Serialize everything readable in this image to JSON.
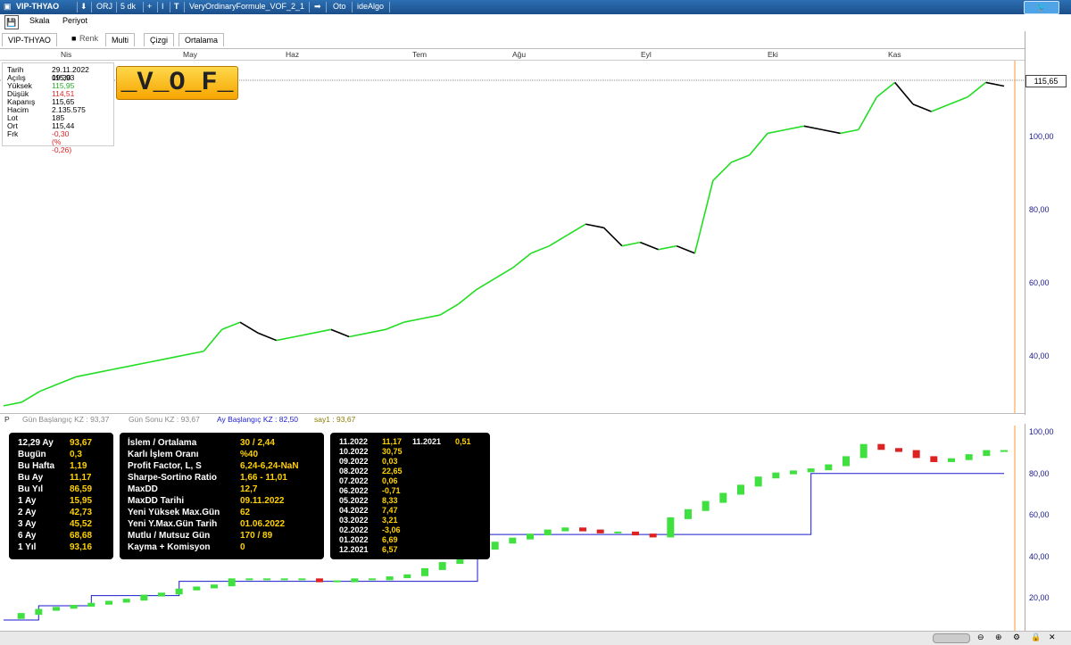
{
  "titlebar": {
    "symbol": "VIP-THYAO",
    "type": "ORJ",
    "period": "5 dk",
    "formula": "VeryOrdinaryFormule_VOF_2_1",
    "mode": "Oto",
    "app": "ideAlgo"
  },
  "menu": {
    "scale": "Skala",
    "period": "Periyot"
  },
  "tabs": {
    "symbol": "VIP-THYAO",
    "color": "Renk",
    "multi": "Multi",
    "line": "Çizgi",
    "average": "Ortalama"
  },
  "months": [
    "Nis",
    "May",
    "Haz",
    "Tem",
    "Ağu",
    "Eyl",
    "Eki",
    "Kas"
  ],
  "y_axis_top": [
    "100,00",
    "80,00",
    "60,00",
    "40,00"
  ],
  "y_axis_bottom": [
    "100,00",
    "80,00",
    "60,00",
    "40,00",
    "20,00"
  ],
  "current_price": "115,65",
  "logo_text": "_V_O_F_",
  "info": [
    {
      "label": "Tarih",
      "value": "29.11.2022 09:30"
    },
    {
      "label": "Açılış",
      "value": "115,93"
    },
    {
      "label": "Yüksek",
      "value": "115,95"
    },
    {
      "label": "Düşük",
      "value": "114,51"
    },
    {
      "label": "Kapanış",
      "value": "115,65"
    },
    {
      "label": "Hacim",
      "value": "2.135.575"
    },
    {
      "label": "Lot",
      "value": "185"
    },
    {
      "label": "Ort",
      "value": "115,44"
    },
    {
      "label": "Frk",
      "value": "-0,30 (% -0,26)"
    }
  ],
  "status": {
    "p": "P",
    "day_start": "Gün Başlangıç KZ : 93,37",
    "day_end": "Gün Sonu KZ : 93,67",
    "month_start": "Ay Başlangıç KZ : 82,50",
    "say1": "say1 : 93,67"
  },
  "perf": [
    {
      "label": "12,29 Ay",
      "value": "93,67"
    },
    {
      "label": "Bugün",
      "value": "0,3"
    },
    {
      "label": "Bu Hafta",
      "value": "1,19"
    },
    {
      "label": "Bu Ay",
      "value": "11,17"
    },
    {
      "label": "Bu Yıl",
      "value": "86,59"
    },
    {
      "label": "1 Ay",
      "value": "15,95"
    },
    {
      "label": "2 Ay",
      "value": "42,73"
    },
    {
      "label": "3 Ay",
      "value": "45,52"
    },
    {
      "label": "6 Ay",
      "value": "68,68"
    },
    {
      "label": "1 Yıl",
      "value": "93,16"
    }
  ],
  "stats": [
    {
      "label": "İslem / Ortalama",
      "value": "30 / 2,44"
    },
    {
      "label": "Karlı İşlem Oranı",
      "value": "%40"
    },
    {
      "label": "Profit Factor, L, S",
      "value": "6,24-6,24-NaN"
    },
    {
      "label": "Sharpe-Sortino Ratio",
      "value": "1,66 - 11,01"
    },
    {
      "label": "MaxDD",
      "value": "12,7"
    },
    {
      "label": "MaxDD Tarihi",
      "value": "09.11.2022"
    },
    {
      "label": "Yeni Yüksek Max.Gün",
      "value": "62"
    },
    {
      "label": "Yeni Y.Max.Gün Tarih",
      "value": "01.06.2022"
    },
    {
      "label": "Mutlu / Mutsuz Gün",
      "value": "170 / 89"
    },
    {
      "label": "Kayma + Komisyon",
      "value": "0"
    }
  ],
  "monthly": [
    {
      "label": "11.2022",
      "value": "11,17"
    },
    {
      "label": "10.2022",
      "value": "30,75"
    },
    {
      "label": "09.2022",
      "value": "0,03"
    },
    {
      "label": "08.2022",
      "value": "22,65"
    },
    {
      "label": "07.2022",
      "value": "0,06"
    },
    {
      "label": "06.2022",
      "value": "-0,71"
    },
    {
      "label": "05.2022",
      "value": "8,33"
    },
    {
      "label": "04.2022",
      "value": "7,47"
    },
    {
      "label": "03.2022",
      "value": "3,21"
    },
    {
      "label": "02.2022",
      "value": "-3,06"
    },
    {
      "label": "01.2022",
      "value": "6,69"
    },
    {
      "label": "12.2021",
      "value": "6,57"
    }
  ],
  "prev_year": {
    "label": "11.2021",
    "value": "0,51"
  },
  "colors": {
    "up": "#22dd22",
    "down": "#000000",
    "equity_up": "#3fe03f",
    "equity_down": "#dd2222",
    "step_line": "#1a1acc",
    "axis_text": "#1a1a8c",
    "panel_value": "#ffd200",
    "marker": "#ff9933"
  },
  "chart_data": [
    {
      "type": "line",
      "y_axis_ticks": [
        40,
        60,
        80,
        100
      ],
      "ylim": [
        26,
        123
      ],
      "months": [
        "Nis",
        "May",
        "Haz",
        "Tem",
        "Ağu",
        "Eyl",
        "Eki",
        "Kas"
      ],
      "current_value": 115.65,
      "series": [
        {
          "values": [
            28,
            29,
            32,
            34,
            36,
            37,
            38,
            39,
            40,
            41,
            42,
            43,
            49,
            51,
            48,
            46,
            47,
            48,
            49,
            47,
            48,
            49,
            51,
            52,
            53,
            56,
            60,
            63,
            66,
            70,
            72,
            75,
            78,
            77,
            72,
            73,
            71,
            72,
            70,
            90,
            95,
            97,
            103,
            104,
            105,
            104,
            103,
            104,
            113,
            117,
            111,
            109,
            111,
            113,
            117,
            116
          ]
        }
      ]
    },
    {
      "type": "line",
      "y_axis_ticks": [
        20,
        40,
        60,
        80,
        100
      ],
      "ylim": [
        10,
        102
      ],
      "series": [
        {
          "values": [
            11,
            13,
            15,
            16,
            17,
            18,
            19,
            20,
            22,
            23,
            25,
            26,
            27,
            30,
            30,
            30,
            30,
            30,
            29,
            29,
            30,
            30,
            31,
            32,
            35,
            38,
            42,
            45,
            48,
            50,
            52,
            54,
            55,
            54,
            53,
            53,
            52,
            51,
            60,
            64,
            68,
            72,
            76,
            80,
            82,
            83,
            84,
            86,
            90,
            96,
            94,
            93,
            90,
            88,
            89,
            91,
            93,
            93
          ]
        },
        {
          "values": [
            10,
            10,
            17,
            17,
            17,
            22,
            22,
            22,
            22,
            22,
            29,
            29,
            29,
            29,
            29,
            29,
            29,
            29,
            29,
            29,
            29,
            29,
            29,
            29,
            29,
            29,
            29,
            52,
            52,
            52,
            52,
            52,
            52,
            52,
            52,
            52,
            52,
            52,
            52,
            52,
            52,
            52,
            52,
            52,
            52,
            52,
            82,
            82,
            82,
            82,
            82,
            82,
            82,
            82,
            82,
            82,
            82,
            82
          ]
        }
      ]
    }
  ]
}
